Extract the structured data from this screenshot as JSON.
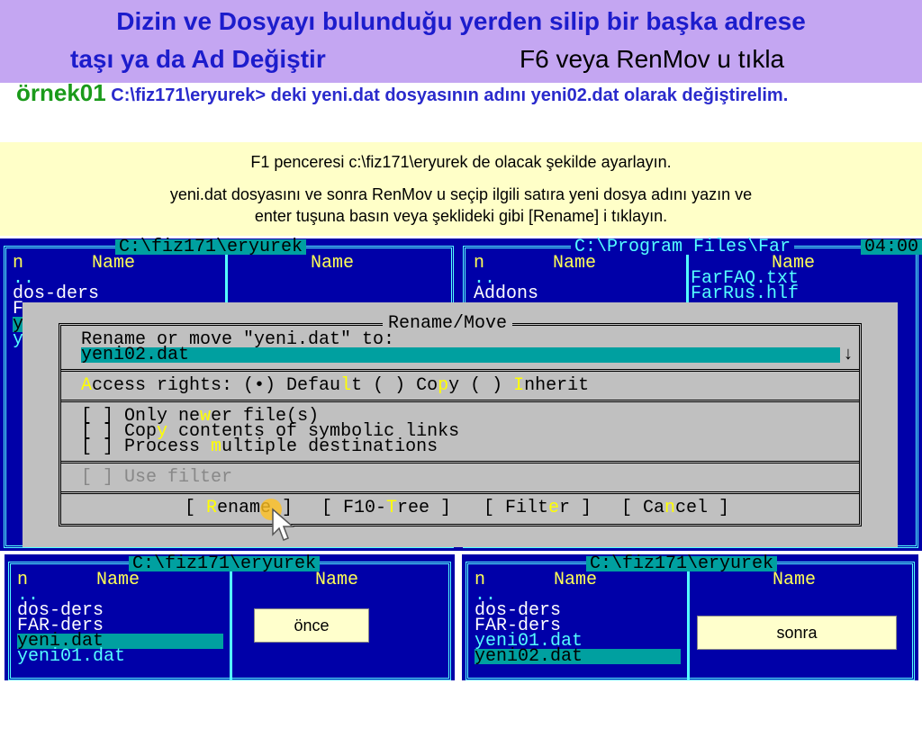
{
  "slide": {
    "title_line1": "Dizin ve Dosyayı bulunduğu yerden silip bir başka adrese",
    "title_line2": "taşı  ya da Ad Değiştir",
    "title_hint": "F6 veya RenMov u tıkla",
    "example_label": "örnek01",
    "example_text": " C:\\fiz171\\eryurek> deki yeni.dat dosyasının adını yeni02.dat olarak değiştirelim.",
    "note1": "F1 penceresi c:\\fiz171\\eryurek de olacak şekilde ayarlayın.",
    "note2": "yeni.dat dosyasını ve sonra RenMov u seçip  ilgili satıra yeni dosya adını yazın ve",
    "note3": "enter tuşuna basın veya şeklideki gibi  [Rename] i tıklayın."
  },
  "top": {
    "left_path": "C:\\fiz171\\eryurek",
    "right_path": "C:\\Program Files\\Far",
    "clock": "04:00",
    "col_n": "n",
    "col_name": "Name",
    "left_files": [
      "..",
      "dos-ders",
      "F",
      "y",
      "y"
    ],
    "right_files": [
      "..",
      "Addons"
    ],
    "right_files2": [
      "FarFAQ.txt",
      "FarRus.hlf"
    ]
  },
  "dialog": {
    "title": "Rename/Move",
    "prompt": "Rename or move \"yeni.dat\" to:",
    "value": "yeni02.dat",
    "access": [
      "A",
      "ccess rights: (•) Defau",
      "l",
      "t ( ) Co",
      "p",
      "y ( ) ",
      "I",
      "nherit"
    ],
    "opt1": [
      "[ ] Only ne",
      "w",
      "er file(s)"
    ],
    "opt2": [
      "[ ] Cop",
      "y",
      " contents of symbolic links"
    ],
    "opt3": [
      "[ ] Process ",
      "m",
      "ultiple destinations"
    ],
    "filter": "[ ] Use filter",
    "btn_rename": [
      "[ ",
      "R",
      "ename ]"
    ],
    "btn_tree": [
      "[ F10-",
      "T",
      "ree ]"
    ],
    "btn_filter": [
      "[ Filt",
      "e",
      "r ]"
    ],
    "btn_cancel": [
      "[ Ca",
      "n",
      "cel ]"
    ]
  },
  "bottom": {
    "path": "C:\\fiz171\\eryurek",
    "col_n": "n",
    "col_name": "Name",
    "before": [
      "..",
      "dos-ders",
      "FAR-ders",
      "yeni.dat",
      "yeni01.dat"
    ],
    "after": [
      "..",
      "dos-ders",
      "FAR-ders",
      "yeni01.dat",
      "yeni02.dat"
    ],
    "label_before": "önce",
    "label_after": "sonra"
  }
}
